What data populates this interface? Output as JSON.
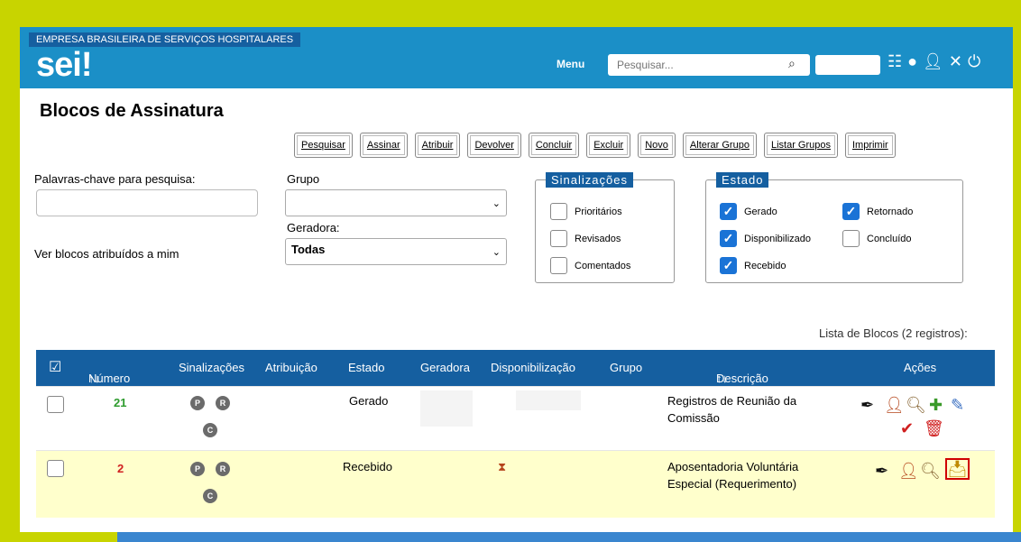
{
  "header": {
    "org": "EMPRESA BRASILEIRA DE SERVIÇOS HOSPITALARES",
    "logo": "sei!",
    "menu": "Menu",
    "search_placeholder": "Pesquisar...",
    "icons": [
      "list-icon",
      "info-icon",
      "user-icon",
      "tools-icon",
      "power-icon"
    ]
  },
  "page_title": "Blocos de Assinatura",
  "toolbar": {
    "buttons": [
      "Pesquisar",
      "Assinar",
      "Atribuir",
      "Devolver",
      "Concluir",
      "Excluir",
      "Novo",
      "Alterar Grupo",
      "Listar Grupos",
      "Imprimir"
    ]
  },
  "filters": {
    "keywords_label": "Palavras-chave para pesquisa:",
    "group_label": "Grupo",
    "group_value": "",
    "generator_label": "Geradora:",
    "generator_value": "Todas",
    "assigned_label": "Ver blocos atribuídos a mim"
  },
  "sinalizacoes": {
    "legend": "Sinalizações",
    "items": [
      {
        "label": "Prioritários",
        "checked": false
      },
      {
        "label": "Revisados",
        "checked": false
      },
      {
        "label": "Comentados",
        "checked": false
      }
    ]
  },
  "estado": {
    "legend": "Estado",
    "items": [
      {
        "label": "Gerado",
        "checked": true
      },
      {
        "label": "Disponibilizado",
        "checked": true
      },
      {
        "label": "Recebido",
        "checked": true
      },
      {
        "label": "Retornado",
        "checked": true
      },
      {
        "label": "Concluído",
        "checked": false
      }
    ]
  },
  "list_caption": "Lista de Blocos (2 registros):",
  "table": {
    "columns": [
      "Número",
      "Sinalizações",
      "Atribuição",
      "Estado",
      "Geradora",
      "Disponibilização",
      "Grupo",
      "Descrição",
      "Ações"
    ],
    "rows": [
      {
        "numero": "21",
        "numero_color": "#2e9b2e",
        "estado": "Gerado",
        "descricao_l1": "Registros de Reunião da",
        "descricao_l2": "Comissão",
        "flags": [
          "P",
          "R",
          "C"
        ]
      },
      {
        "numero": "2",
        "numero_color": "#d02020",
        "estado": "Recebido",
        "descricao_l1": "Aposentadoria Voluntária",
        "descricao_l2": "Especial (Requerimento)",
        "flags": [
          "P",
          "R",
          "C"
        ]
      }
    ]
  },
  "colors": {
    "topbar": "#1b8fc7",
    "table_header": "#155fa0",
    "highlight_row": "#ffffcc",
    "frame": "#c8d400"
  }
}
